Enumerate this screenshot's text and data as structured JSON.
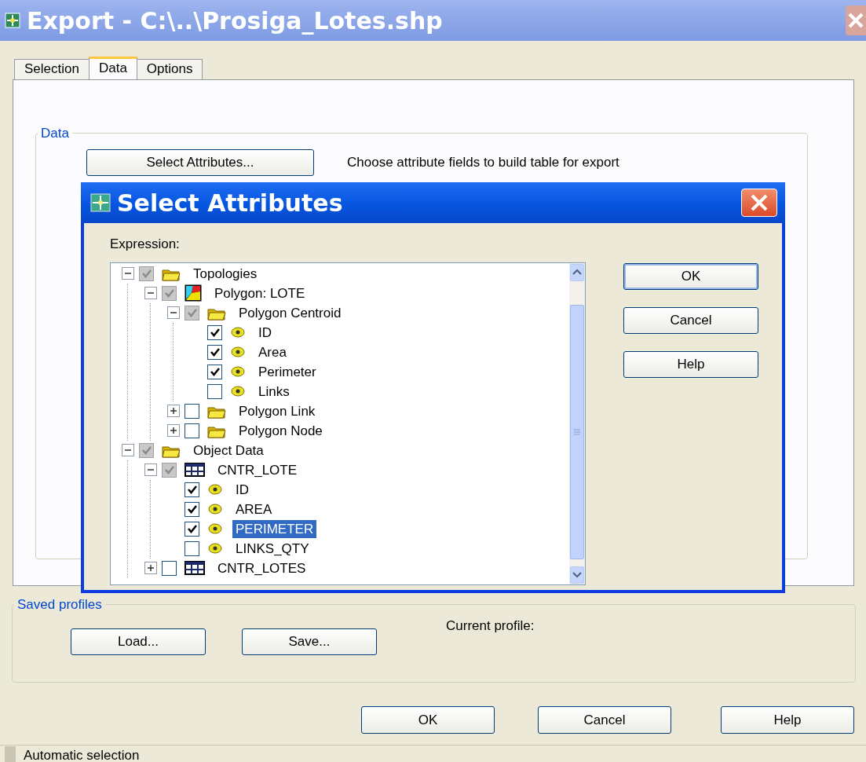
{
  "window": {
    "title": "Export - C:\\..\\Prosiga_Lotes.shp"
  },
  "tabs": [
    {
      "label": "Selection",
      "selected": false
    },
    {
      "label": "Data",
      "selected": true
    },
    {
      "label": "Options",
      "selected": false
    }
  ],
  "data_group": {
    "legend": "Data",
    "button": "Select Attributes...",
    "description": "Choose attribute fields to build table for export"
  },
  "select_attributes_dialog": {
    "title": "Select Attributes",
    "expression_label": "Expression:",
    "tree": {
      "items": [
        {
          "label": "Topologies",
          "kind": "folder",
          "checked": true,
          "grayed": true,
          "selected": false,
          "expanded": true,
          "children": [
            {
              "label": "Polygon: LOTE",
              "kind": "polygon",
              "checked": true,
              "grayed": true,
              "selected": false,
              "expanded": true,
              "children": [
                {
                  "label": "Polygon Centroid",
                  "kind": "folder",
                  "checked": true,
                  "grayed": true,
                  "selected": false,
                  "expanded": true,
                  "children": [
                    {
                      "label": "ID",
                      "kind": "field",
                      "checked": true,
                      "grayed": false,
                      "selected": false
                    },
                    {
                      "label": "Area",
                      "kind": "field",
                      "checked": true,
                      "grayed": false,
                      "selected": false
                    },
                    {
                      "label": "Perimeter",
                      "kind": "field",
                      "checked": true,
                      "grayed": false,
                      "selected": false
                    },
                    {
                      "label": "Links",
                      "kind": "field",
                      "checked": false,
                      "grayed": false,
                      "selected": false
                    }
                  ]
                },
                {
                  "label": "Polygon Link",
                  "kind": "folder",
                  "checked": false,
                  "grayed": false,
                  "selected": false,
                  "expanded": false
                },
                {
                  "label": "Polygon Node",
                  "kind": "folder",
                  "checked": false,
                  "grayed": false,
                  "selected": false,
                  "expanded": false
                }
              ]
            }
          ]
        },
        {
          "label": "Object Data",
          "kind": "folder",
          "checked": true,
          "grayed": true,
          "selected": false,
          "expanded": true,
          "children": [
            {
              "label": "CNTR_LOTE",
              "kind": "table",
              "checked": true,
              "grayed": true,
              "selected": false,
              "expanded": true,
              "children": [
                {
                  "label": "ID",
                  "kind": "field",
                  "checked": true,
                  "grayed": false,
                  "selected": false
                },
                {
                  "label": "AREA",
                  "kind": "field",
                  "checked": true,
                  "grayed": false,
                  "selected": false
                },
                {
                  "label": "PERIMETER",
                  "kind": "field",
                  "checked": true,
                  "grayed": false,
                  "selected": true
                },
                {
                  "label": "LINKS_QTY",
                  "kind": "field",
                  "checked": false,
                  "grayed": false,
                  "selected": false
                }
              ]
            },
            {
              "label": "CNTR_LOTES",
              "kind": "table",
              "checked": false,
              "grayed": false,
              "selected": false,
              "expanded": false
            }
          ]
        }
      ]
    },
    "buttons": [
      {
        "label": "OK",
        "default": true
      },
      {
        "label": "Cancel",
        "default": false
      },
      {
        "label": "Help",
        "default": false
      }
    ]
  },
  "saved_profiles": {
    "legend": "Saved profiles",
    "buttons": [
      "Load...",
      "Save..."
    ],
    "current_profile_label": "Current profile:"
  },
  "buttons": [
    {
      "label": "OK",
      "default": false
    },
    {
      "label": "Cancel",
      "default": false
    },
    {
      "label": "Help",
      "default": false
    }
  ],
  "status_bar": {
    "text": "Automatic selection"
  }
}
